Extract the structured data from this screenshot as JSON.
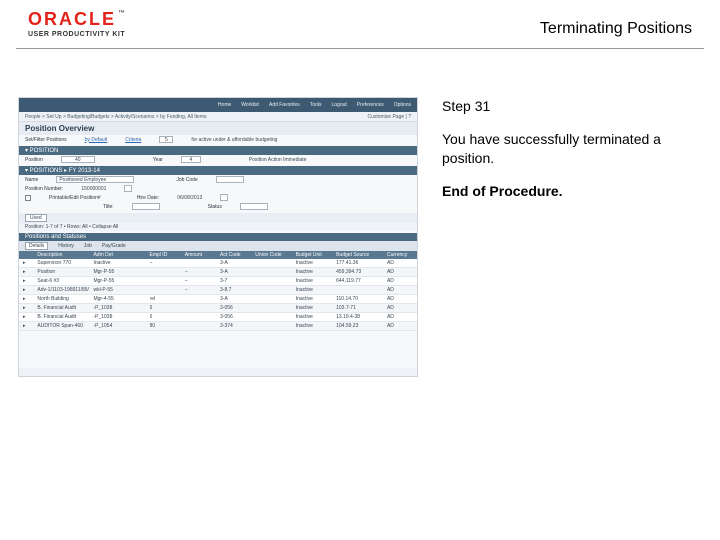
{
  "header": {
    "logo_text": "ORACLE",
    "logo_sub": "USER PRODUCTIVITY KIT",
    "tm": "™",
    "title": "Terminating Positions"
  },
  "instructions": {
    "step": "Step 31",
    "body": "You have successfully terminated a position.",
    "end": "End of Procedure."
  },
  "screenshot": {
    "topnav": [
      "Home",
      "Worklist",
      "Add Favorites",
      "Tools",
      "Logout",
      "Preferences",
      "Options"
    ],
    "breadcrumb_left": "People > Set Up > Budgeting/Budgets > Activity/Scenarios > by Funding, All Items",
    "breadcrumb_right": "Customize Page  |  ?",
    "page_title": "Position Overview",
    "filter": {
      "set_label": "Set/Filter Positions",
      "default_label": "by Default",
      "criteria_label": "Criteria",
      "value1": "5",
      "note": "for active under & affordable budgeting"
    },
    "form": {
      "position_label": "Position",
      "position_val": "40",
      "year_label": "Year",
      "year_val": "4",
      "action_label": "Position Action Immediate"
    },
    "section1": "▾ POSITIONS ▸ FY 2013-14",
    "row_line": {
      "name_label": "Name",
      "name_val": "Positioned Employee",
      "job_label": "Job Code",
      "num_label": "Position Number:",
      "num_val": "150000001",
      "hiredate_label": "Hire Date:",
      "hiredate_val": "06/08/2013",
      "title_label": "Title:",
      "status_label": "Status",
      "printable_label": "Printable/Edit Position#"
    },
    "tabs_label": "Used",
    "pager": "Position: 1-7 of 7     •  Rows: All  •  Collapse All",
    "grid_section": "Positions and Statuses",
    "grid_tabs": [
      "Details",
      "History",
      "Job",
      "Pay/Grade"
    ],
    "grid_head": [
      "",
      "Description",
      "Adm Det",
      "Empl ID",
      "Amount",
      "Act Code",
      "Union Code",
      "Budget Unit",
      "Budget Source",
      "Currency"
    ],
    "rows": [
      [
        "▸",
        "Supervisor 770",
        "Inactive",
        "–",
        "",
        "3-A",
        "",
        "Inactive",
        "177.41.36",
        "AD"
      ],
      [
        "▸",
        "Position",
        "Mgr-P-55",
        "",
        "–",
        "3-A",
        "",
        "Inactive",
        "459,394.73",
        "AD"
      ],
      [
        "▸",
        "Seat-6 #3",
        "Mgr-P-55",
        "",
        "–",
        "3-7",
        "",
        "Inactive",
        "644,119.77",
        "AD"
      ],
      [
        "▸",
        "Adv-1/1103-198911/85/7",
        "wkl-P-55",
        "",
        "–",
        "3-8.7",
        "",
        "Inactive",
        "",
        "AD"
      ],
      [
        "▸",
        "North Building",
        "Mgr-4-55",
        "rel",
        "",
        "3-A",
        "",
        "Inactive",
        "110.14.70",
        "AD"
      ],
      [
        "▸",
        "B. Financial Audit",
        "-P_1038",
        "6",
        "",
        "3-056",
        "",
        "Inactive",
        "103.7-71",
        "AD"
      ],
      [
        "▸",
        "B. Financial Audit",
        "-P_1038",
        "6",
        "",
        "3-056",
        "",
        "Inactive",
        "13.19.4-38",
        "AD"
      ],
      [
        "▸",
        "AUDITOR Span-460",
        "-P_1054",
        "80",
        "",
        "3-374",
        "",
        "Inactive",
        "104.59.23",
        "AD"
      ]
    ]
  }
}
